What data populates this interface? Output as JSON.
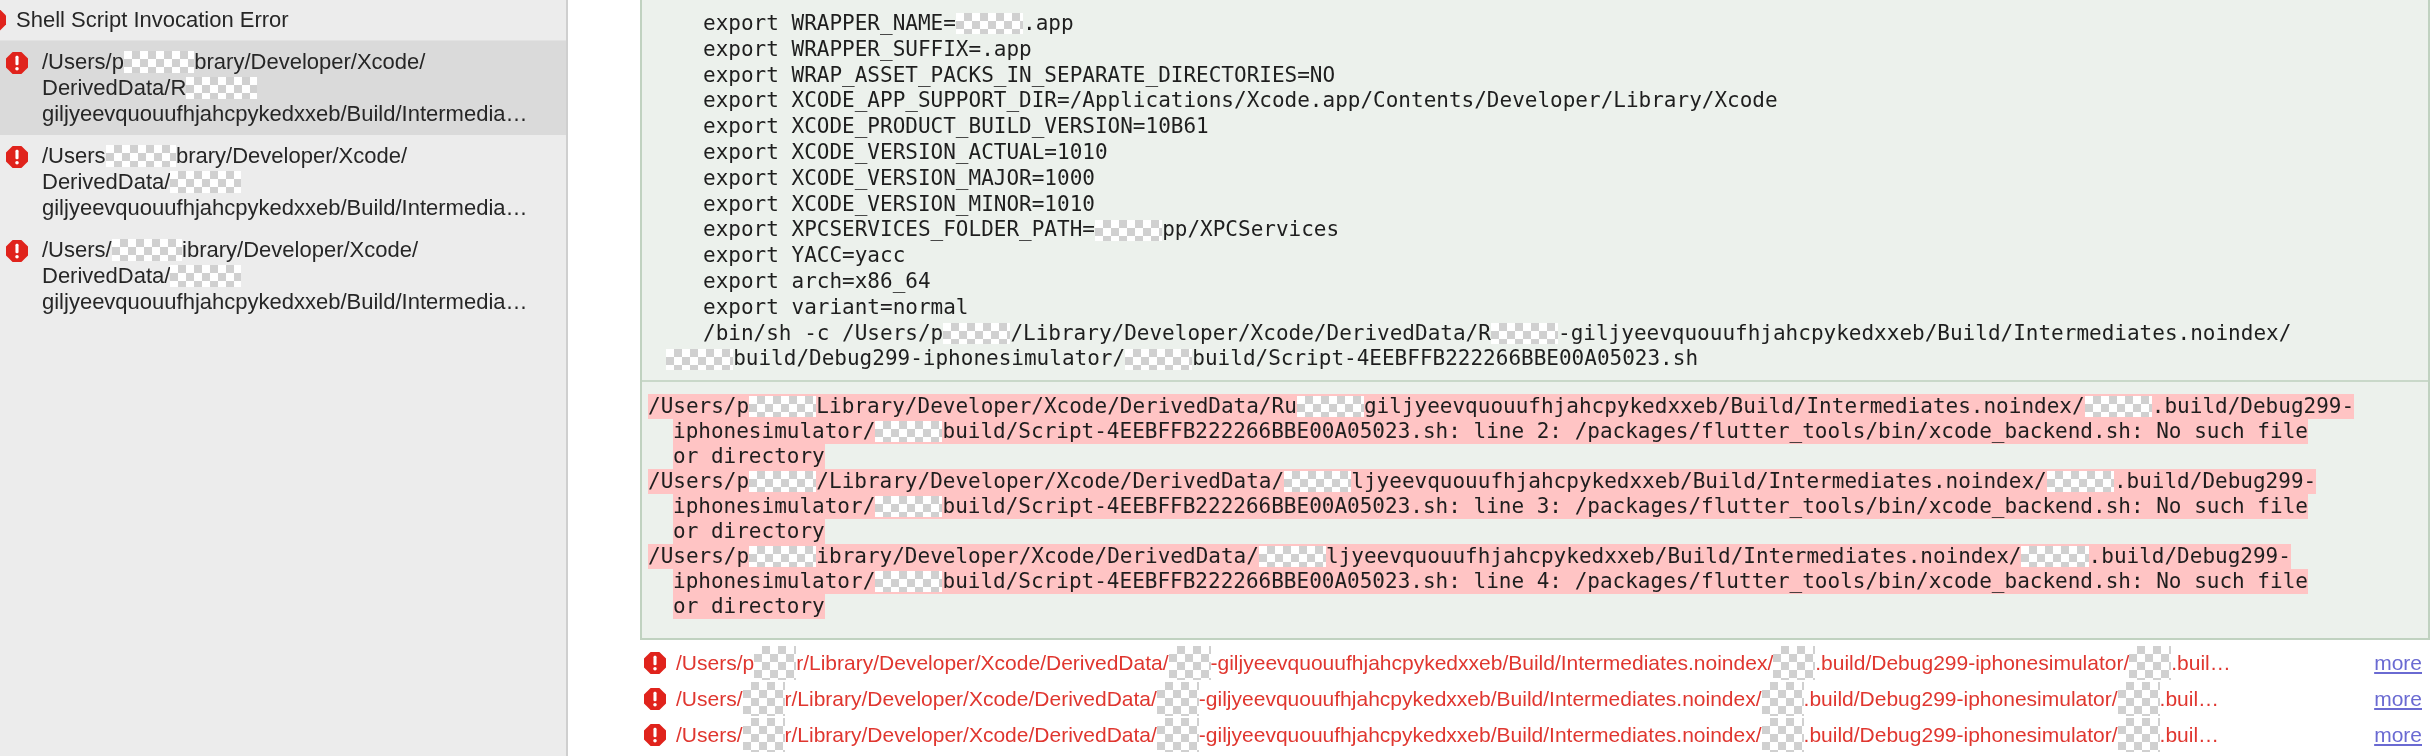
{
  "sidebar": {
    "header": {
      "title": "Shell Script Invocation Error"
    },
    "items": [
      {
        "selected": true,
        "lines": [
          [
            {
              "kind": "text",
              "text": "/Users/p"
            },
            {
              "kind": "redacted"
            },
            {
              "kind": "text",
              "text": "brary/Developer/Xcode/"
            }
          ],
          [
            {
              "kind": "text",
              "text": "DerivedData/R"
            },
            {
              "kind": "redacted"
            }
          ],
          [
            {
              "kind": "text",
              "text": "giljyeevquouufhjahcpykedxxeb/Build/Intermedia…"
            }
          ]
        ]
      },
      {
        "selected": false,
        "lines": [
          [
            {
              "kind": "text",
              "text": "/Users"
            },
            {
              "kind": "redacted"
            },
            {
              "kind": "text",
              "text": "brary/Developer/Xcode/"
            }
          ],
          [
            {
              "kind": "text",
              "text": "DerivedData/"
            },
            {
              "kind": "redacted"
            }
          ],
          [
            {
              "kind": "text",
              "text": "giljyeevquouufhjahcpykedxxeb/Build/Intermedia…"
            }
          ]
        ]
      },
      {
        "selected": false,
        "lines": [
          [
            {
              "kind": "text",
              "text": "/Users/"
            },
            {
              "kind": "redacted"
            },
            {
              "kind": "text",
              "text": "ibrary/Developer/Xcode/"
            }
          ],
          [
            {
              "kind": "text",
              "text": "DerivedData/"
            },
            {
              "kind": "redacted"
            }
          ],
          [
            {
              "kind": "text",
              "text": "giljyeevquouufhjahcpykedxxeb/Build/Intermedia…"
            }
          ]
        ]
      }
    ]
  },
  "log": {
    "script_lines": [
      {
        "kind": "line",
        "parts": [
          {
            "kind": "text",
            "text": "export WRAPPER_NAME="
          },
          {
            "kind": "redacted"
          },
          {
            "kind": "text",
            "text": ".app"
          }
        ]
      },
      {
        "kind": "line",
        "parts": [
          {
            "kind": "text",
            "text": "export WRAPPER_SUFFIX=.app"
          }
        ]
      },
      {
        "kind": "line",
        "parts": [
          {
            "kind": "text",
            "text": "export WRAP_ASSET_PACKS_IN_SEPARATE_DIRECTORIES=NO"
          }
        ]
      },
      {
        "kind": "line",
        "parts": [
          {
            "kind": "text",
            "text": "export XCODE_APP_SUPPORT_DIR=/Applications/Xcode.app/Contents/Developer/Library/Xcode"
          }
        ]
      },
      {
        "kind": "line",
        "parts": [
          {
            "kind": "text",
            "text": "export XCODE_PRODUCT_BUILD_VERSION=10B61"
          }
        ]
      },
      {
        "kind": "line",
        "parts": [
          {
            "kind": "text",
            "text": "export XCODE_VERSION_ACTUAL=1010"
          }
        ]
      },
      {
        "kind": "line",
        "parts": [
          {
            "kind": "text",
            "text": "export XCODE_VERSION_MAJOR=1000"
          }
        ]
      },
      {
        "kind": "line",
        "parts": [
          {
            "kind": "text",
            "text": "export XCODE_VERSION_MINOR=1010"
          }
        ]
      },
      {
        "kind": "line",
        "parts": [
          {
            "kind": "text",
            "text": "export XPCSERVICES_FOLDER_PATH="
          },
          {
            "kind": "redacted"
          },
          {
            "kind": "text",
            "text": "pp/XPCServices"
          }
        ]
      },
      {
        "kind": "line",
        "parts": [
          {
            "kind": "text",
            "text": "export YACC=yacc"
          }
        ]
      },
      {
        "kind": "line",
        "parts": [
          {
            "kind": "text",
            "text": "export arch=x86_64"
          }
        ]
      },
      {
        "kind": "line",
        "parts": [
          {
            "kind": "text",
            "text": "export variant=normal"
          }
        ]
      },
      {
        "kind": "line",
        "parts": [
          {
            "kind": "text",
            "text": "/bin/sh -c /Users/p"
          },
          {
            "kind": "redacted"
          },
          {
            "kind": "text",
            "text": "/Library/Developer/Xcode/DerivedData/R"
          },
          {
            "kind": "redacted"
          },
          {
            "kind": "text",
            "text": "-giljyeevquouufhjahcpykedxxeb/Build/Intermediates.noindex/"
          }
        ]
      },
      {
        "kind": "cont",
        "parts": [
          {
            "kind": "redacted"
          },
          {
            "kind": "text",
            "text": "build/Debug299-iphonesimulator/"
          },
          {
            "kind": "redacted"
          },
          {
            "kind": "text",
            "text": "build/Script-4EEBFFB222266BBE00A05023.sh"
          }
        ]
      }
    ],
    "errors": [
      {
        "lines": [
          [
            {
              "kind": "text",
              "text": "/Users/p"
            },
            {
              "kind": "redacted"
            },
            {
              "kind": "text",
              "text": "Library/Developer/Xcode/DerivedData/Ru"
            },
            {
              "kind": "redacted"
            },
            {
              "kind": "text",
              "text": "giljyeevquouufhjahcpykedxxeb/Build/Intermediates.noindex/"
            },
            {
              "kind": "redacted"
            },
            {
              "kind": "text",
              "text": ".build/Debug299-"
            }
          ],
          [
            {
              "kind": "text",
              "text": "iphonesimulator/"
            },
            {
              "kind": "redacted"
            },
            {
              "kind": "text",
              "text": "build/Script-4EEBFFB222266BBE00A05023.sh: line 2: /packages/flutter_tools/bin/xcode_backend.sh: No such file"
            }
          ],
          [
            {
              "kind": "text",
              "text": "or directory"
            }
          ]
        ]
      },
      {
        "lines": [
          [
            {
              "kind": "text",
              "text": "/Users/p"
            },
            {
              "kind": "redacted"
            },
            {
              "kind": "text",
              "text": "/Library/Developer/Xcode/DerivedData/"
            },
            {
              "kind": "redacted"
            },
            {
              "kind": "text",
              "text": "ljyeevquouufhjahcpykedxxeb/Build/Intermediates.noindex/"
            },
            {
              "kind": "redacted"
            },
            {
              "kind": "text",
              "text": ".build/Debug299-"
            }
          ],
          [
            {
              "kind": "text",
              "text": "iphonesimulator/"
            },
            {
              "kind": "redacted"
            },
            {
              "kind": "text",
              "text": "build/Script-4EEBFFB222266BBE00A05023.sh: line 3: /packages/flutter_tools/bin/xcode_backend.sh: No such file"
            }
          ],
          [
            {
              "kind": "text",
              "text": "or directory"
            }
          ]
        ]
      },
      {
        "lines": [
          [
            {
              "kind": "text",
              "text": "/Users/p"
            },
            {
              "kind": "redacted"
            },
            {
              "kind": "text",
              "text": "ibrary/Developer/Xcode/DerivedData/"
            },
            {
              "kind": "redacted"
            },
            {
              "kind": "text",
              "text": "ljyeevquouufhjahcpykedxxeb/Build/Intermediates.noindex/"
            },
            {
              "kind": "redacted"
            },
            {
              "kind": "text",
              "text": ".build/Debug299-"
            }
          ],
          [
            {
              "kind": "text",
              "text": "iphonesimulator/"
            },
            {
              "kind": "redacted"
            },
            {
              "kind": "text",
              "text": "build/Script-4EEBFFB222266BBE00A05023.sh: line 4: /packages/flutter_tools/bin/xcode_backend.sh: No such file"
            }
          ],
          [
            {
              "kind": "text",
              "text": "or directory"
            }
          ]
        ]
      }
    ]
  },
  "issues": [
    {
      "parts": [
        {
          "kind": "text",
          "text": "/Users/p"
        },
        {
          "kind": "redacted"
        },
        {
          "kind": "text",
          "text": "r/Library/Developer/Xcode/DerivedData/"
        },
        {
          "kind": "redacted"
        },
        {
          "kind": "text",
          "text": "-giljyeevquouufhjahcpykedxxeb/Build/Intermediates.noindex/"
        },
        {
          "kind": "redacted"
        },
        {
          "kind": "text",
          "text": ".build/Debug299-iphonesimulator/"
        },
        {
          "kind": "redacted"
        },
        {
          "kind": "text",
          "text": ".buil…"
        }
      ],
      "link": "more"
    },
    {
      "parts": [
        {
          "kind": "text",
          "text": "/Users/"
        },
        {
          "kind": "redacted"
        },
        {
          "kind": "text",
          "text": "r/Library/Developer/Xcode/DerivedData/"
        },
        {
          "kind": "redacted"
        },
        {
          "kind": "text",
          "text": "-giljyeevquouufhjahcpykedxxeb/Build/Intermediates.noindex/"
        },
        {
          "kind": "redacted"
        },
        {
          "kind": "text",
          "text": ".build/Debug299-iphonesimulator/"
        },
        {
          "kind": "redacted"
        },
        {
          "kind": "text",
          "text": ".buil…"
        }
      ],
      "link": "more"
    },
    {
      "parts": [
        {
          "kind": "text",
          "text": "/Users/"
        },
        {
          "kind": "redacted"
        },
        {
          "kind": "text",
          "text": "r/Library/Developer/Xcode/DerivedData/"
        },
        {
          "kind": "redacted"
        },
        {
          "kind": "text",
          "text": "-giljyeevquouufhjahcpykedxxeb/Build/Intermediates.noindex/"
        },
        {
          "kind": "redacted"
        },
        {
          "kind": "text",
          "text": ".build/Debug299-iphonesimulator/"
        },
        {
          "kind": "redacted"
        },
        {
          "kind": "text",
          "text": ".buil…"
        }
      ],
      "link": "more"
    }
  ]
}
